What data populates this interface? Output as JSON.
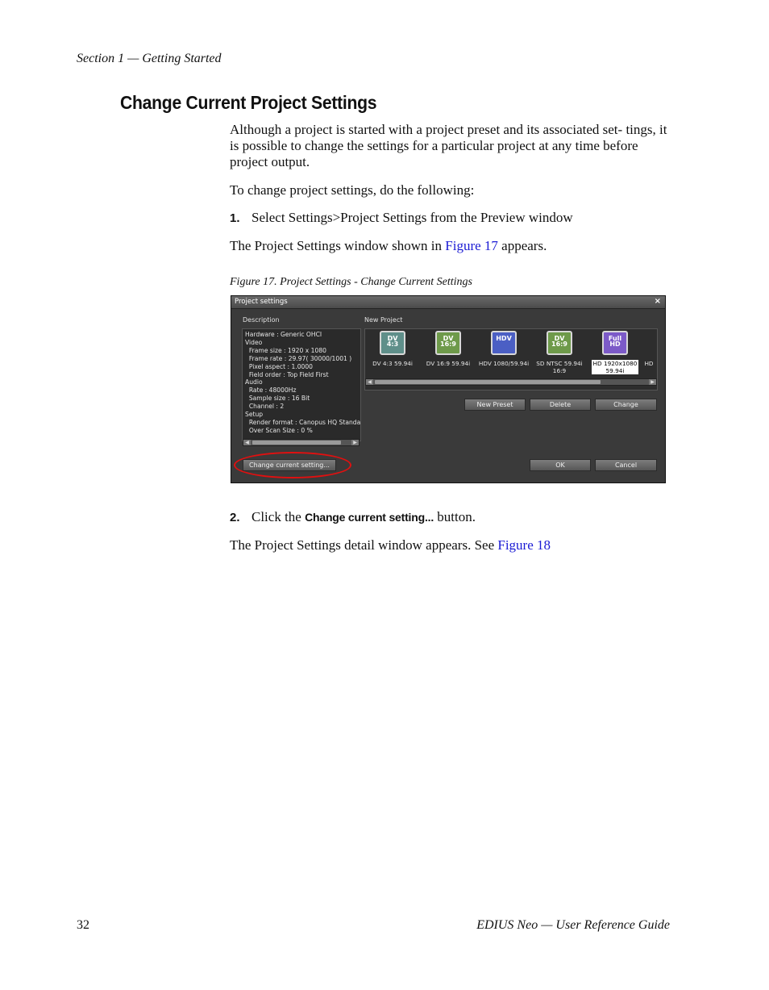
{
  "header": {
    "section": "Section 1 — Getting Started"
  },
  "title": "Change Current Project Settings",
  "para1": "Although a project is started with a project preset and its associated set- tings, it is possible to change the settings for a particular project at any time before project output.",
  "para2": "To change project settings, do the following:",
  "step1": {
    "num": "1.",
    "text": "Select Settings>Project Settings from the Preview window"
  },
  "para3": {
    "before": "The Project Settings window shown in ",
    "link": "Figure 17",
    "after": " appears."
  },
  "caption": "Figure 17.  Project Settings - Change Current Settings",
  "screenshot": {
    "window_title": "Project settings",
    "close": "×",
    "description_label": "Description",
    "new_project_label": "New Project",
    "description_lines": [
      "Hardware : Generic OHCI",
      "Video",
      "  Frame size : 1920 x 1080",
      "  Frame rate : 29.97( 30000/1001 )",
      "  Pixel aspect : 1.0000",
      "  Field order : Top Field First",
      "Audio",
      "  Rate : 48000Hz",
      "  Sample size : 16 Bit",
      "  Channel : 2",
      "Setup",
      "  Render format : Canopus HQ Standa",
      "  Over Scan Size : 0 %"
    ],
    "presets": [
      {
        "icon": "DV\n4:3",
        "name": "DV 4:3 59.94i",
        "color": "#5f8f8a"
      },
      {
        "icon": "DV\n16:9",
        "name": "DV 16:9 59.94i",
        "color": "#6e9a4a"
      },
      {
        "icon": "HDV",
        "name": "HDV 1080/59.94i",
        "color": "#4b5fc4"
      },
      {
        "icon": "DV\n16:9",
        "name": "SD NTSC 59.94i\n16:9",
        "color": "#6e9a4a"
      },
      {
        "icon": "Full\nHD",
        "name": "HD 1920x1080\n59.94i",
        "color": "#7c5ac8",
        "selected": true
      },
      {
        "icon": "",
        "name": "HD",
        "color": "#444"
      }
    ],
    "buttons": {
      "new_preset": "New Preset",
      "delete": "Delete",
      "change": "Change",
      "change_current": "Change current setting...",
      "ok": "OK",
      "cancel": "Cancel"
    },
    "scroll_arrow_left": "◀",
    "scroll_arrow_right": "▶",
    "scroll_thumb_mark": "|||"
  },
  "step2": {
    "num": "2.",
    "before": "Click the ",
    "bold": "Change current setting...",
    "after": " button."
  },
  "para4": {
    "before": "The Project Settings detail window appears. See ",
    "link": "Figure 18"
  },
  "footer": {
    "page": "32",
    "guide": "EDIUS Neo  —  User Reference Guide"
  }
}
